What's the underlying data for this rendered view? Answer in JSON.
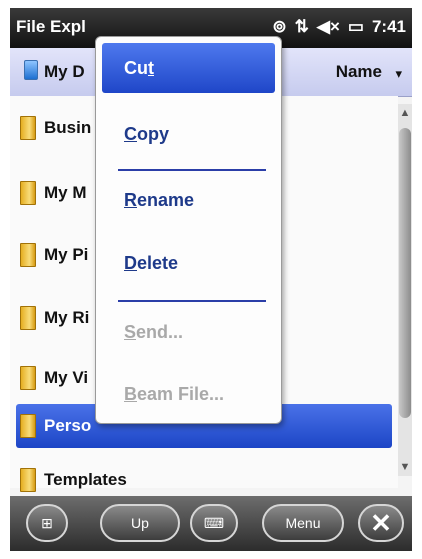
{
  "statusbar": {
    "title": "File Expl",
    "icons": [
      "connectivity-icon",
      "signal-icon",
      "volume-icon",
      "battery-icon"
    ],
    "time": "7:41"
  },
  "pathbar": {
    "current_folder": "My D",
    "sort_label": "Name",
    "sort_arrow": "▾"
  },
  "files": [
    {
      "label": "Busin"
    },
    {
      "label": "My M"
    },
    {
      "label": "My Pi"
    },
    {
      "label": "My Ri"
    },
    {
      "label": "My Vi"
    },
    {
      "label": "Perso",
      "selected": true
    },
    {
      "label": "Templates"
    }
  ],
  "context_menu": {
    "items": [
      {
        "pre": "Cu",
        "ul": "t",
        "post": "",
        "state": "highlighted"
      },
      {
        "pre": "",
        "ul": "C",
        "post": "opy",
        "state": "enabled"
      },
      {
        "pre": "",
        "ul": "R",
        "post": "ename",
        "state": "enabled"
      },
      {
        "pre": "",
        "ul": "D",
        "post": "elete",
        "state": "enabled"
      },
      {
        "pre": "",
        "ul": "S",
        "post": "end...",
        "state": "disabled"
      },
      {
        "pre": "",
        "ul": "B",
        "post": "eam File...",
        "state": "disabled"
      }
    ]
  },
  "softkeys": {
    "up": "Up",
    "menu": "Menu"
  },
  "colors": {
    "highlight": "#2a55d6",
    "menu_text": "#1e3a8a",
    "disabled_text": "#a9a9a9"
  }
}
